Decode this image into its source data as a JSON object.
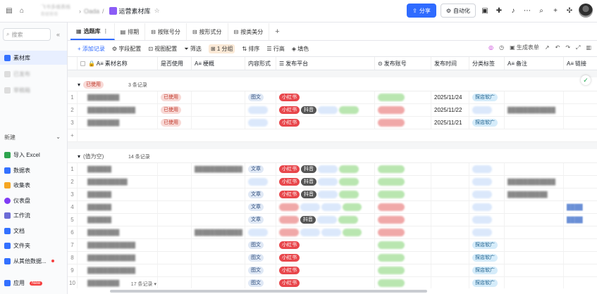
{
  "topbar": {
    "breadcrumb_line1": "飞书多维表格",
    "breadcrumb_line2": "数据管理",
    "parent_page": "Oada",
    "doc_title": "运营素材库",
    "share_label": "分享",
    "automation_label": "自动化"
  },
  "sidebar": {
    "search_placeholder": "搜索",
    "tables": [
      {
        "label": "素材库",
        "active": true
      },
      {
        "label": "已发布",
        "active": false
      },
      {
        "label": "草稿箱",
        "active": false
      }
    ],
    "new_label": "新建",
    "menu": [
      {
        "label": "导入 Excel",
        "color": "#2da44e"
      },
      {
        "label": "数据表",
        "color": "#3370ff"
      },
      {
        "label": "收集表",
        "color": "#f5a623"
      },
      {
        "label": "仪表盘",
        "color": "#7f3bf5"
      },
      {
        "label": "工作流",
        "color": "#6b6bd6"
      },
      {
        "label": "文档",
        "color": "#3370ff"
      },
      {
        "label": "文件夹",
        "color": "#3370ff"
      },
      {
        "label": "从其他数据...",
        "color": "#3370ff"
      }
    ],
    "app_label": "应用",
    "app_badge": "New"
  },
  "tabs": [
    {
      "label": "选题库",
      "active": true
    },
    {
      "label": "排期",
      "active": false
    },
    {
      "label": "按账号分",
      "active": false
    },
    {
      "label": "按形式分",
      "active": false
    },
    {
      "label": "按类美分",
      "active": false
    }
  ],
  "toolbar": {
    "add_record": "+ 添加记录",
    "field_config": "字段配置",
    "view_config": "视图配置",
    "filter": "筛选",
    "group": "1 分组",
    "sort": "排序",
    "row_height": "行高",
    "fill_color": "填色",
    "generate_form": "生成表单"
  },
  "columns": [
    {
      "label": "素材名称"
    },
    {
      "label": "是否使用"
    },
    {
      "label": "梗概"
    },
    {
      "label": "内容形式"
    },
    {
      "label": "发布平台"
    },
    {
      "label": "发布账号"
    },
    {
      "label": "发布时间"
    },
    {
      "label": "分类标签"
    },
    {
      "label": "备注"
    },
    {
      "label": "链接"
    }
  ],
  "groups": [
    {
      "label": "已使用",
      "count": "3 条记录",
      "rows": [
        {
          "n": "1",
          "name": "████████",
          "used": "已使用",
          "form": "图文",
          "platforms": [
            "小红书"
          ],
          "date": "2025/11/24",
          "tag": "探店软广",
          "note": ""
        },
        {
          "n": "2",
          "name": "████████████",
          "used": "已使用",
          "form": "████",
          "platforms": [
            "小红书",
            "抖音",
            "blue",
            "grn"
          ],
          "date": "2025/11/22",
          "tag": "████",
          "note": "████████████"
        },
        {
          "n": "3",
          "name": "████████",
          "used": "已使用",
          "form": "████",
          "platforms": [
            "小红书"
          ],
          "date": "2025/11/21",
          "tag": "探店软广",
          "note": ""
        }
      ]
    },
    {
      "label": "(值为空)",
      "count": "14 条记录",
      "rows": [
        {
          "n": "1",
          "name": "██████",
          "summary": "████████████",
          "form": "文章",
          "platforms": [
            "小红书",
            "抖音",
            "blue",
            "grn"
          ],
          "tag": "████",
          "note": ""
        },
        {
          "n": "2",
          "name": "██████████",
          "form": "████",
          "platforms": [
            "小红书",
            "抖音",
            "blue",
            "grn"
          ],
          "tag": "████",
          "note": "████████████"
        },
        {
          "n": "3",
          "name": "██████",
          "form": "文章",
          "platforms": [
            "小红书",
            "抖音",
            "blue",
            "grn"
          ],
          "tag": "████",
          "note": "██████████"
        },
        {
          "n": "4",
          "name": "██████",
          "form": "文章",
          "platforms": [
            "red",
            "blue",
            "dy",
            "grn"
          ],
          "tag": "████",
          "note": "",
          "link": "████"
        },
        {
          "n": "5",
          "name": "██████",
          "form": "文章",
          "platforms": [
            "red",
            "抖音",
            "blue",
            "grn"
          ],
          "tag": "████",
          "note": "",
          "link": "████"
        },
        {
          "n": "6",
          "name": "████████",
          "summary": "████████████",
          "form": "████",
          "platforms": [
            "red",
            "blue",
            "blue",
            "grn"
          ],
          "tag": "████",
          "note": ""
        },
        {
          "n": "7",
          "name": "████████████",
          "form": "图文",
          "platforms": [
            "小红书"
          ],
          "tag": "探店软广",
          "note": ""
        },
        {
          "n": "8",
          "name": "████████████",
          "form": "图文",
          "platforms": [
            "小红书"
          ],
          "tag": "探店软广",
          "note": ""
        },
        {
          "n": "9",
          "name": "████████████",
          "form": "图文",
          "platforms": [
            "小红书"
          ],
          "tag": "探店软广",
          "note": ""
        },
        {
          "n": "10",
          "name": "████████",
          "form": "图文",
          "platforms": [
            "小红书"
          ],
          "tag": "探店软广",
          "note": ""
        }
      ]
    }
  ],
  "footer_count": "17 条记录"
}
